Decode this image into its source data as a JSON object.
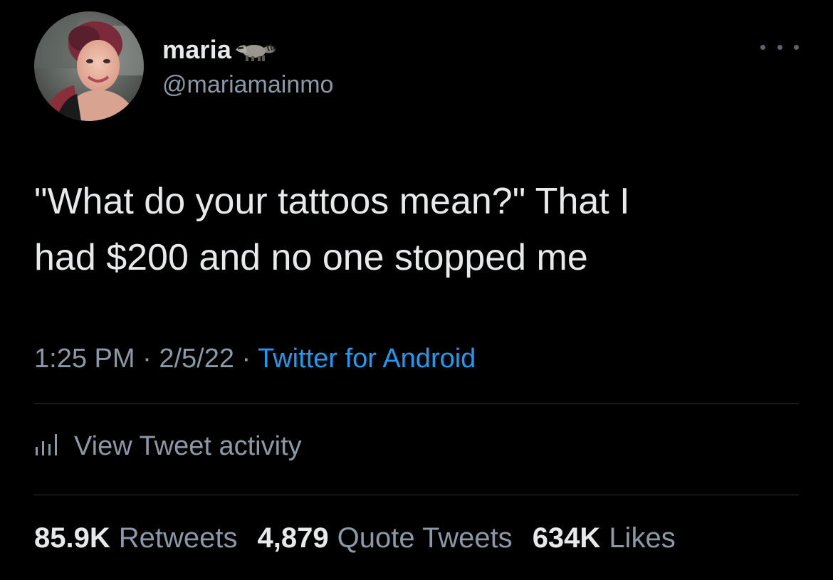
{
  "author": {
    "display_name": "maria",
    "name_emoji_icon": "raccoon-icon",
    "handle": "@mariamainmo",
    "avatar_icon": "profile-photo"
  },
  "tweet": {
    "text": "\"What do your tattoos mean?\" That I\nhad $200 and no one stopped me"
  },
  "meta": {
    "time": "1:25 PM",
    "sep1": " · ",
    "date": "2/5/22",
    "sep2": " · ",
    "source": "Twitter for Android"
  },
  "activity": {
    "icon": "analytics-bars-icon",
    "label": "View Tweet activity"
  },
  "stats": {
    "retweets_count": "85.9K",
    "retweets_label": "Retweets",
    "quotes_count": "4,879",
    "quotes_label": "Quote Tweets",
    "likes_count": "634K",
    "likes_label": "Likes"
  },
  "colors": {
    "background": "#000000",
    "primary_text": "#e7e9ea",
    "secondary_text": "#8b98a5",
    "link": "#1d9bf0",
    "divider": "#2f3336"
  }
}
